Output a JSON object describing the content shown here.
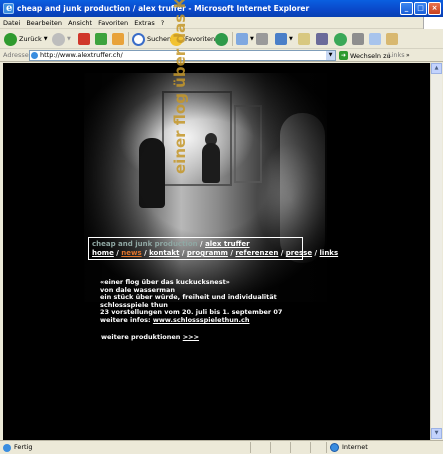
{
  "window": {
    "title": "cheap and junk production / alex truffer - Microsoft Internet Explorer"
  },
  "menu": [
    "Datei",
    "Bearbeiten",
    "Ansicht",
    "Favoriten",
    "Extras",
    "?"
  ],
  "toolbar": {
    "back_label": "Zurück",
    "search_label": "Suchen",
    "favorites_label": "Favoriten"
  },
  "address": {
    "label": "Adresse",
    "url": "http://www.alextruffer.ch/",
    "go_label": "Wechseln zu",
    "links_label": "Links"
  },
  "page": {
    "vertical_title": "einer flog über das Kuckucksnest",
    "nav_title_a": "cheap and junk production",
    "nav_title_sep": " / ",
    "nav_title_b": "alex truffer",
    "nav": [
      "home",
      "news",
      "kontakt",
      "programm",
      "referenzen",
      "presse",
      "links"
    ],
    "nav_active": "news",
    "news_lines": [
      "«einer flog über das kuckucksnest»",
      "von dale wasserman",
      "ein stück über würde, freiheit und individualität",
      "schlossspiele thun",
      "23 vorstellungen vom 20. juli bis 1. september 07"
    ],
    "infos_label": "weitere infos: ",
    "infos_link": "www.schlossspielethun.ch",
    "more_label": "weitere produktionen ",
    "more_link": ">>>"
  },
  "status": {
    "text": "Fertig",
    "zone": "Internet"
  },
  "colors": {
    "accent_nav": "#E0742C",
    "title_teal": "#8FA7A3",
    "vertical_gold": "#C4962B",
    "xp_blue": "#0A47C8"
  },
  "icons": [
    "ie-icon",
    "back-icon",
    "forward-icon",
    "stop-icon",
    "refresh-icon",
    "home-icon",
    "search-icon",
    "favorites-icon",
    "history-icon",
    "mail-icon",
    "print-icon",
    "edit-icon",
    "discuss-icon",
    "messenger-icon",
    "research-icon",
    "cut-icon",
    "copy-icon",
    "paste-icon",
    "globe-icon"
  ]
}
